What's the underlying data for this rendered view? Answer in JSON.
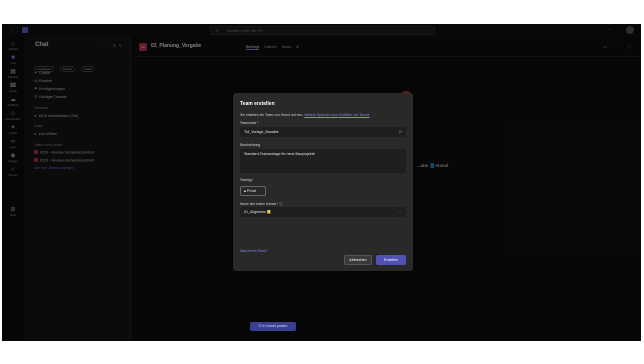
{
  "search": {
    "placeholder": "Suchen (Ctrl+Alt+E)"
  },
  "rail": [
    {
      "icon": "activity-icon",
      "glyph": "⌂",
      "label": "Aktivität"
    },
    {
      "icon": "chat-icon",
      "glyph": "■",
      "label": "Chat"
    },
    {
      "icon": "calendar-icon",
      "glyph": "▦",
      "label": "Kalender"
    },
    {
      "icon": "calls-icon",
      "glyph": "☎",
      "label": "Anrufe"
    },
    {
      "icon": "onedrive-icon",
      "glyph": "☁",
      "label": "OneDrive"
    },
    {
      "icon": "community-icon",
      "glyph": "☺",
      "label": "Communities"
    },
    {
      "icon": "copilot-icon",
      "glyph": "✦",
      "label": "Copilot"
    },
    {
      "icon": "loop-icon",
      "glyph": "∞",
      "label": "Loop"
    },
    {
      "icon": "engage-icon",
      "glyph": "◉",
      "label": "Engage"
    },
    {
      "icon": "planner-icon",
      "glyph": "✓",
      "label": "Planner"
    },
    {
      "icon": "apps-icon",
      "glyph": "⊞",
      "label": "Apps"
    }
  ],
  "chat_pane": {
    "title": "Chat",
    "filters": [
      "Ungelesen",
      "Kanäle",
      "Chats"
    ],
    "quick": [
      {
        "icon": "copilot-icon",
        "glyph": "✦",
        "label": "Copilot"
      },
      {
        "icon": "mention-icon",
        "glyph": "@",
        "label": "Erwähnt"
      },
      {
        "icon": "followed-icon",
        "glyph": "⚑",
        "label": "Ermöglichungen"
      },
      {
        "icon": "threads-icon",
        "glyph": "☷",
        "label": "Gefolgte Threads"
      }
    ],
    "favorites_label": "Favoriten",
    "favorites": [
      "MOD Administrator (Sie)"
    ],
    "chats_label": "Chats",
    "chats": [
      "Dan Wilber"
    ],
    "teams_label": "Teams und Kanäle",
    "teams": [
      "0224 - Neubau Gemeindezentrum",
      "0223 - Neubau Gemeindezentrum"
    ],
    "see_all": "Alle Ihre Teams anzeigen"
  },
  "channel": {
    "avatar": "03",
    "name": "03_Planung_Vergabe",
    "tabs": [
      "Beiträge",
      "Dateien",
      "Notes"
    ],
    "welcome": "...abe 📘-Kanal",
    "new_post": "In Kanal posten"
  },
  "dialog": {
    "title": "Team erstellen",
    "desc": "Sie erstellen ein Team von Grund auf neu.",
    "desc_link": "Weitere Optionen zum Erstellen von Teams",
    "name_label": "Teamname *",
    "name_value": "TM_Vorlage_Bauakte",
    "desc_label": "Beschreibung",
    "desc_value": "Standard-Teamvorlage für neue Bauprojekte",
    "type_label": "Teamtyp",
    "type_value": "Privat",
    "channel_label": "Name des ersten Kanals *",
    "channel_value": "01_Allgemein 📒",
    "help_link": "Was ist ein Team?",
    "cancel": "Abbrechen",
    "create": "Erstellen"
  }
}
